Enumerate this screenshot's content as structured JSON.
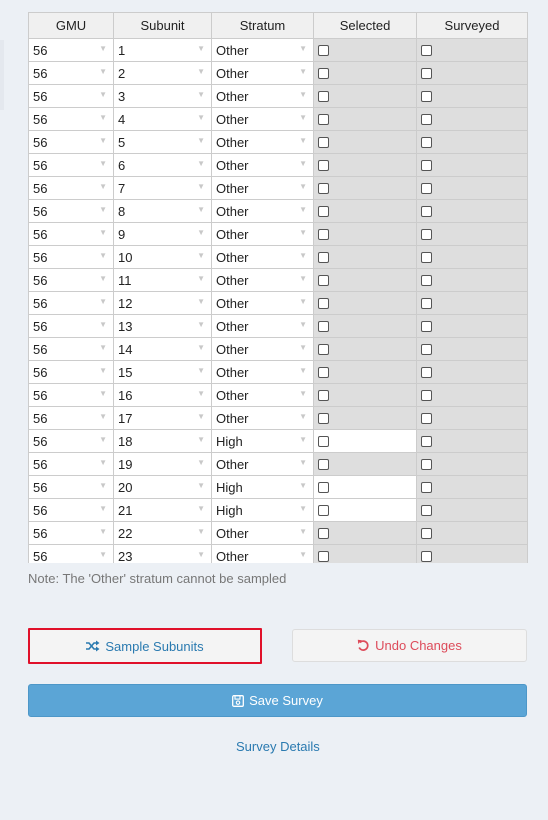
{
  "columns": [
    "GMU",
    "Subunit",
    "Stratum",
    "Selected",
    "Surveyed"
  ],
  "rows": [
    {
      "gmu": "56",
      "subunit": "1",
      "stratum": "Other"
    },
    {
      "gmu": "56",
      "subunit": "2",
      "stratum": "Other"
    },
    {
      "gmu": "56",
      "subunit": "3",
      "stratum": "Other"
    },
    {
      "gmu": "56",
      "subunit": "4",
      "stratum": "Other"
    },
    {
      "gmu": "56",
      "subunit": "5",
      "stratum": "Other"
    },
    {
      "gmu": "56",
      "subunit": "6",
      "stratum": "Other"
    },
    {
      "gmu": "56",
      "subunit": "7",
      "stratum": "Other"
    },
    {
      "gmu": "56",
      "subunit": "8",
      "stratum": "Other"
    },
    {
      "gmu": "56",
      "subunit": "9",
      "stratum": "Other"
    },
    {
      "gmu": "56",
      "subunit": "10",
      "stratum": "Other"
    },
    {
      "gmu": "56",
      "subunit": "11",
      "stratum": "Other"
    },
    {
      "gmu": "56",
      "subunit": "12",
      "stratum": "Other"
    },
    {
      "gmu": "56",
      "subunit": "13",
      "stratum": "Other"
    },
    {
      "gmu": "56",
      "subunit": "14",
      "stratum": "Other"
    },
    {
      "gmu": "56",
      "subunit": "15",
      "stratum": "Other"
    },
    {
      "gmu": "56",
      "subunit": "16",
      "stratum": "Other"
    },
    {
      "gmu": "56",
      "subunit": "17",
      "stratum": "Other"
    },
    {
      "gmu": "56",
      "subunit": "18",
      "stratum": "High"
    },
    {
      "gmu": "56",
      "subunit": "19",
      "stratum": "Other"
    },
    {
      "gmu": "56",
      "subunit": "20",
      "stratum": "High"
    },
    {
      "gmu": "56",
      "subunit": "21",
      "stratum": "High"
    },
    {
      "gmu": "56",
      "subunit": "22",
      "stratum": "Other"
    },
    {
      "gmu": "56",
      "subunit": "23",
      "stratum": "Other"
    }
  ],
  "note": "Note: The 'Other' stratum cannot be sampled",
  "buttons": {
    "sample": "Sample Subunits",
    "undo": "Undo Changes",
    "save": "Save Survey"
  },
  "link_details": "Survey Details",
  "colors": {
    "accent_link": "#2a7ab0",
    "undo_red": "#dd4b5a",
    "save_blue": "#5ba5d6",
    "highlight_border": "#e0102a",
    "disabled_cell": "#dedede"
  }
}
